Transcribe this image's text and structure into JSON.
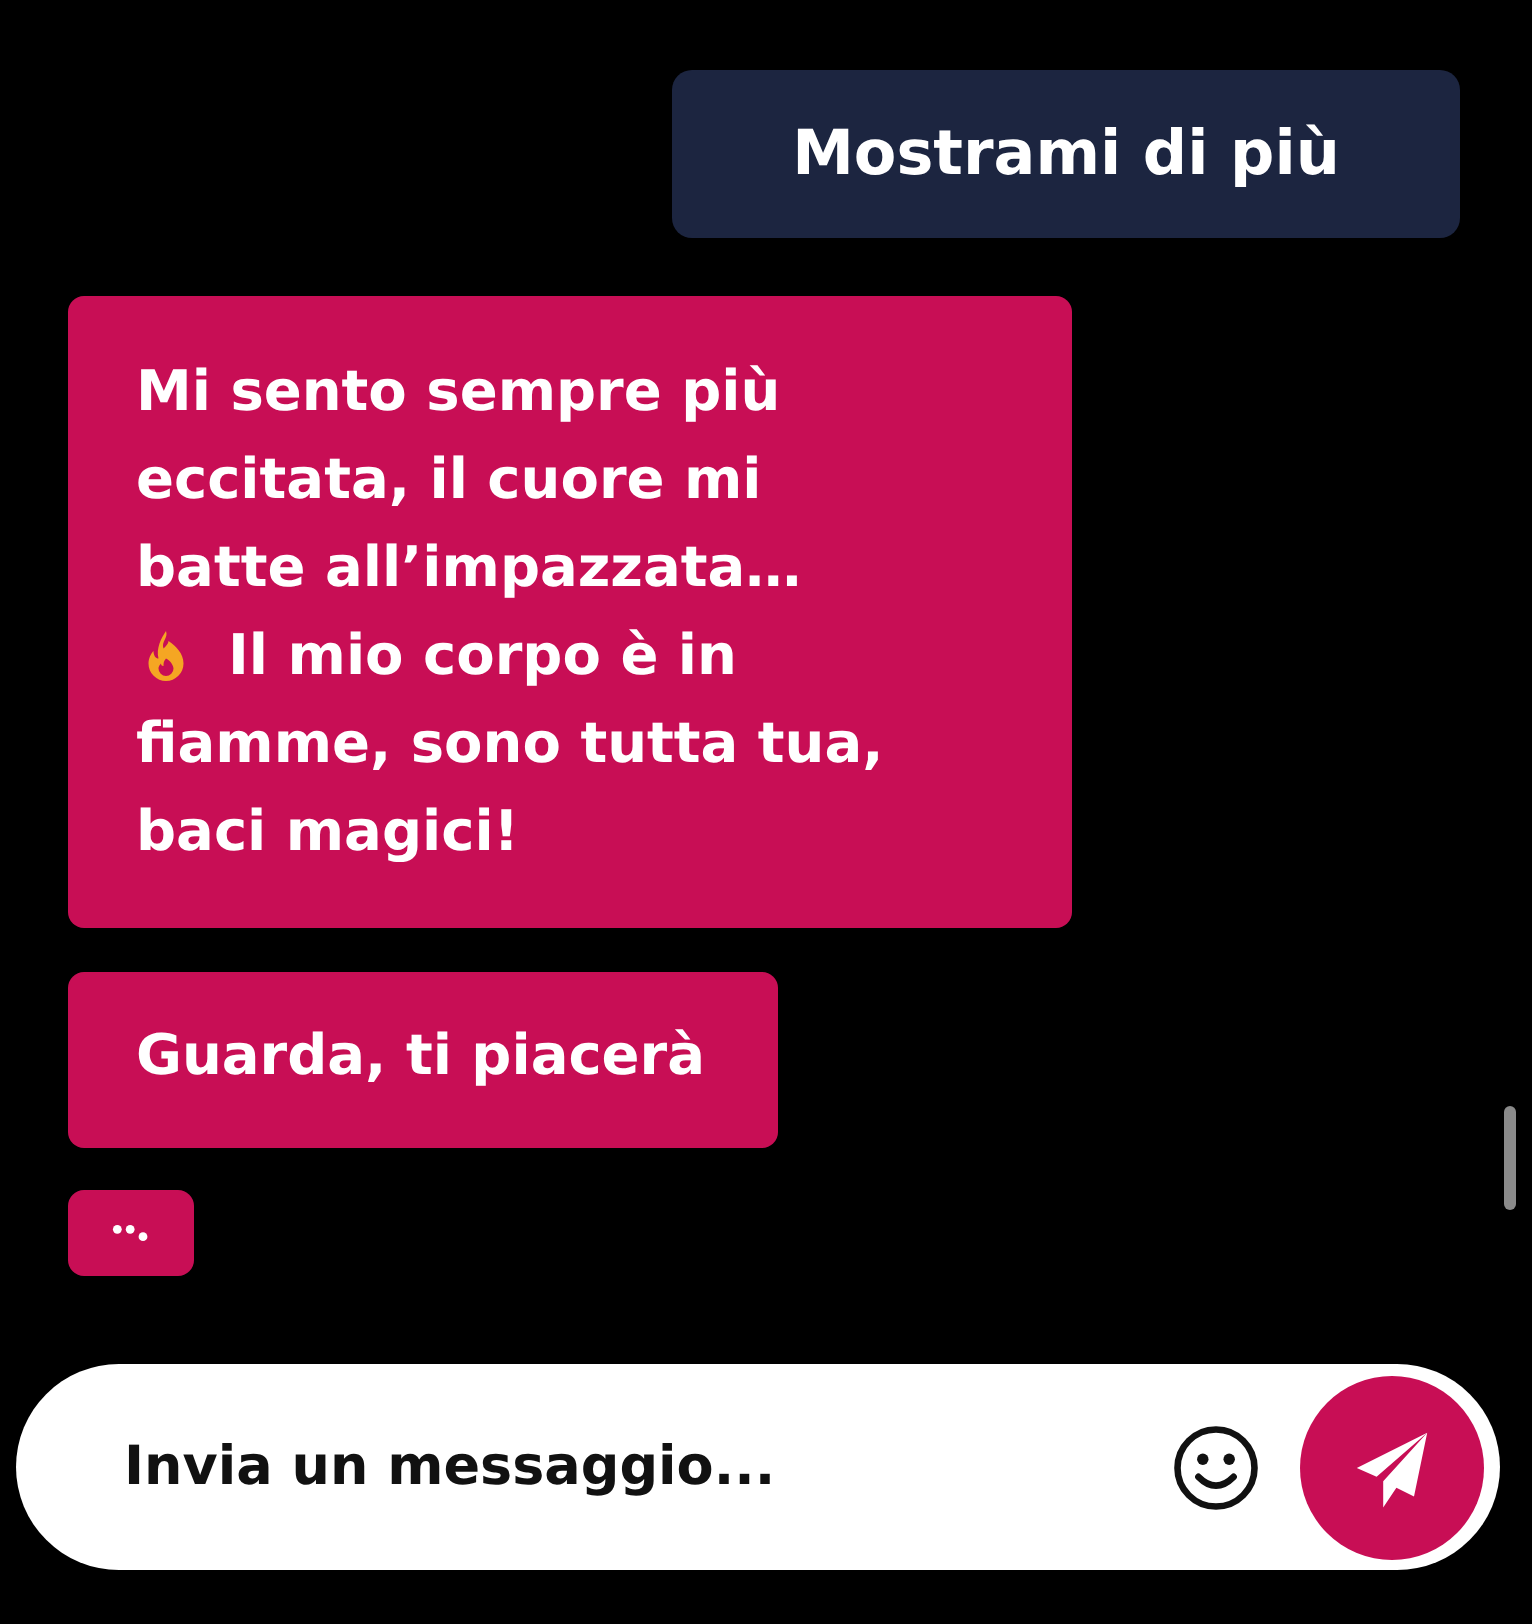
{
  "messages": [
    {
      "outgoing": true,
      "kind": "text",
      "lines": [
        {
          "text": "Mostrami di più"
        }
      ]
    },
    {
      "outgoing": false,
      "kind": "text",
      "lines": [
        {
          "text": "Mi sento sempre più"
        },
        {
          "text": "eccitata, il cuore mi"
        },
        {
          "text": "batte all’impazzata…"
        },
        {
          "kind": "emoji",
          "text": "Il mio corpo è in"
        },
        {
          "text": "fiamme, sono tutta tua,"
        },
        {
          "text": "baci magici!"
        }
      ]
    },
    {
      "outgoing": false,
      "kind": "text",
      "lines": [
        {
          "text": "Guarda, ti piacerà"
        }
      ]
    },
    {
      "outgoing": false,
      "kind": "typing"
    }
  ],
  "composer": {
    "placeholder": "Invia un messaggio..."
  }
}
